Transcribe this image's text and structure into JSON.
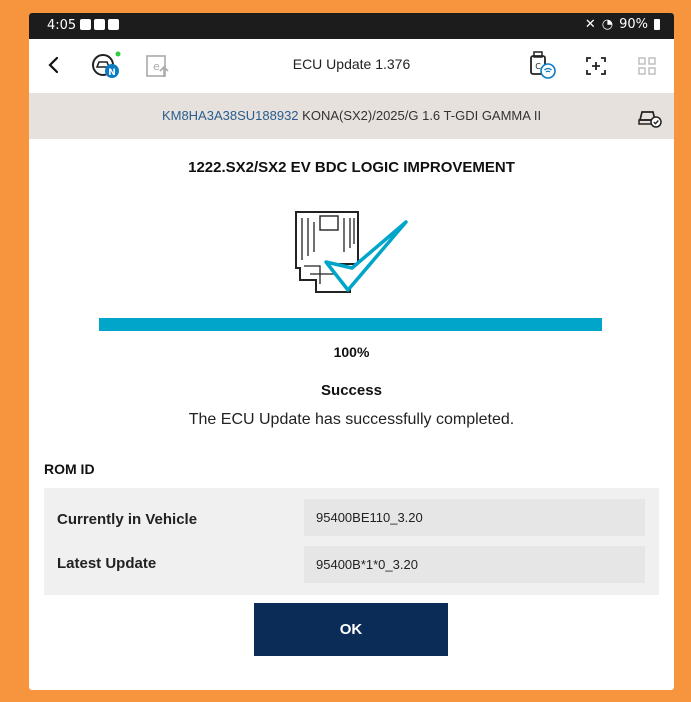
{
  "status_bar": {
    "time": "4:05",
    "battery": "90%"
  },
  "app_bar": {
    "title": "ECU Update 1.376"
  },
  "vehicle": {
    "vin": "KM8HA3A38SU188932",
    "description": "KONA(SX2)/2025/G 1.6 T-GDI GAMMA II"
  },
  "update": {
    "name": "1222.SX2/SX2 EV BDC LOGIC IMPROVEMENT",
    "progress_percent": 100,
    "progress_label": "100%",
    "status": "Success",
    "message": "The ECU Update has successfully completed."
  },
  "rom_id": {
    "title": "ROM ID",
    "rows": [
      {
        "label": "Currently in Vehicle",
        "value": "95400BE110_3.20"
      },
      {
        "label": "Latest Update",
        "value": "95400B*1*0_3.20"
      }
    ]
  },
  "actions": {
    "ok_label": "OK"
  },
  "colors": {
    "progress": "#00a5c9",
    "ok_button": "#0a2c57",
    "vin_text": "#2a5d8f",
    "frame": "#f7943e"
  },
  "icons": [
    "back-arrow-icon",
    "vehicle-connect-icon",
    "ecu-export-icon",
    "vci-wireless-icon",
    "screenshot-icon",
    "grid-menu-icon",
    "vehicle-check-icon",
    "ecu-success-icon"
  ]
}
